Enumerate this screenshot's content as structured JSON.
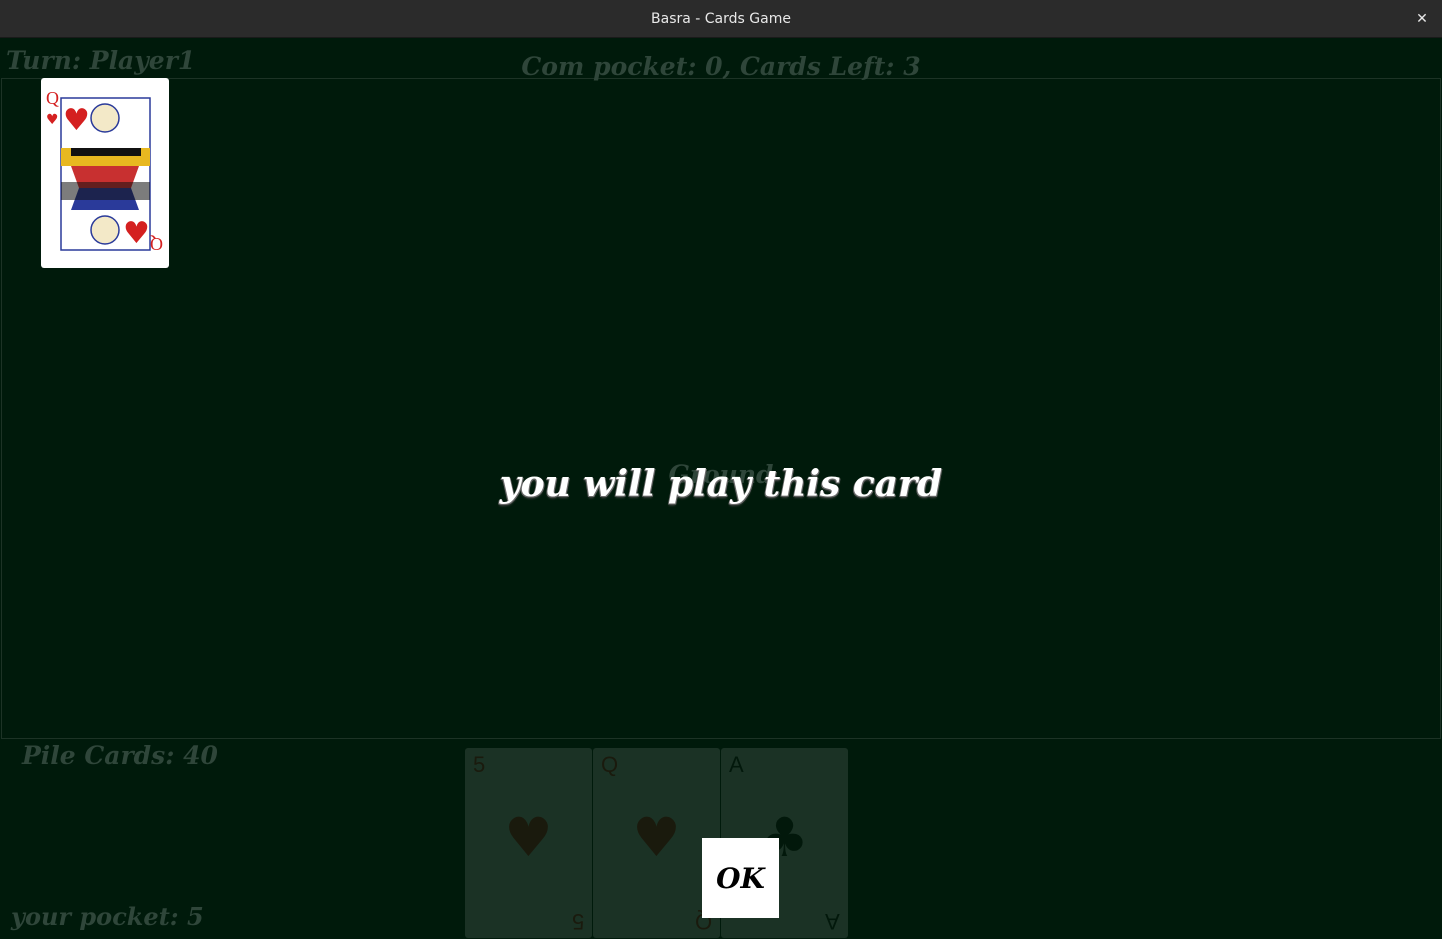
{
  "window": {
    "title": "Basra - Cards Game",
    "close_glyph": "✕"
  },
  "status": {
    "turn": "Turn: Player1",
    "computer": "Com pocket: 0, Cards Left: 3",
    "ground": "Ground",
    "pile": "Pile Cards: 40",
    "your_pocket": "your pocket: 5"
  },
  "played_card": {
    "rank": "Q",
    "suit": "♥",
    "name": "queen-of-hearts"
  },
  "dialog": {
    "message": "you will play this card",
    "ok_label": "OK"
  },
  "hand": [
    {
      "rank": "5",
      "suit": "♥",
      "color": "red"
    },
    {
      "rank": "Q",
      "suit": "♥",
      "color": "red"
    },
    {
      "rank": "A",
      "suit": "♣",
      "color": "black"
    }
  ]
}
